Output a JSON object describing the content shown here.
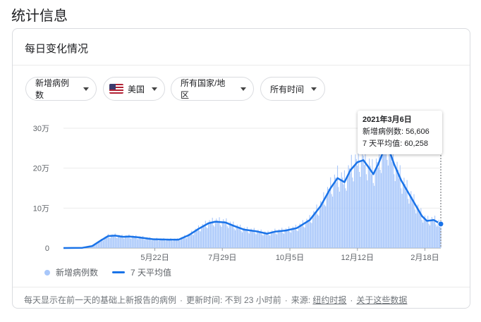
{
  "page_title": "统计信息",
  "card": {
    "title": "每日变化情况"
  },
  "filters": [
    {
      "label": "新增病例数"
    },
    {
      "label": "美国"
    },
    {
      "label": "所有国家/地区"
    },
    {
      "label": "所有时间"
    }
  ],
  "tooltip": {
    "date": "2021年3月6日",
    "cases_label": "新增病例数",
    "cases_value": "56,606",
    "avg_label": "7 天平均值",
    "avg_value": "60,258"
  },
  "legend": {
    "bars_label": "新增病例数",
    "line_label": "7 天平均值"
  },
  "footer": {
    "note": "每天显示在前一天的基础上新报告的病例",
    "updated": "更新时间: 不到 23 小时前",
    "source_label": "来源:",
    "source_link": "纽约时报",
    "about_link": "关于这些数据"
  },
  "colors": {
    "bars": "#a8c7fa",
    "line": "#1a73e8",
    "grid": "#ebebeb"
  },
  "chart_data": {
    "type": "bar",
    "series": [
      {
        "name": "新增病例数",
        "type": "bar"
      },
      {
        "name": "7 天平均值",
        "type": "line"
      }
    ],
    "y_ticks": [
      "0",
      "10万",
      "20万",
      "30万"
    ],
    "ylim": [
      0,
      300000
    ],
    "x_ticks": [
      "5月22日",
      "7月29日",
      "10月5日",
      "12月12日",
      "2月18日"
    ],
    "x_range": [
      "2020-02-20",
      "2021-03-06"
    ],
    "avg_points": [
      [
        "2020-02-20",
        0
      ],
      [
        "2020-03-10",
        500
      ],
      [
        "2020-03-20",
        5000
      ],
      [
        "2020-03-28",
        18000
      ],
      [
        "2020-04-05",
        30000
      ],
      [
        "2020-04-12",
        31000
      ],
      [
        "2020-04-20",
        28000
      ],
      [
        "2020-04-26",
        29000
      ],
      [
        "2020-05-05",
        27000
      ],
      [
        "2020-05-20",
        22000
      ],
      [
        "2020-06-05",
        21000
      ],
      [
        "2020-06-15",
        21000
      ],
      [
        "2020-06-25",
        32000
      ],
      [
        "2020-07-05",
        48000
      ],
      [
        "2020-07-15",
        62000
      ],
      [
        "2020-07-22",
        66000
      ],
      [
        "2020-08-01",
        64000
      ],
      [
        "2020-08-10",
        55000
      ],
      [
        "2020-08-20",
        46000
      ],
      [
        "2020-09-01",
        42000
      ],
      [
        "2020-09-12",
        36000
      ],
      [
        "2020-09-20",
        41000
      ],
      [
        "2020-10-01",
        44000
      ],
      [
        "2020-10-12",
        50000
      ],
      [
        "2020-10-25",
        70000
      ],
      [
        "2020-11-05",
        105000
      ],
      [
        "2020-11-15",
        150000
      ],
      [
        "2020-11-22",
        175000
      ],
      [
        "2020-11-29",
        165000
      ],
      [
        "2020-12-05",
        195000
      ],
      [
        "2020-12-12",
        215000
      ],
      [
        "2020-12-18",
        220000
      ],
      [
        "2020-12-24",
        200000
      ],
      [
        "2020-12-28",
        185000
      ],
      [
        "2021-01-02",
        210000
      ],
      [
        "2021-01-08",
        248000
      ],
      [
        "2021-01-12",
        252000
      ],
      [
        "2021-01-18",
        210000
      ],
      [
        "2021-01-25",
        170000
      ],
      [
        "2021-02-01",
        140000
      ],
      [
        "2021-02-08",
        110000
      ],
      [
        "2021-02-15",
        80000
      ],
      [
        "2021-02-20",
        68000
      ],
      [
        "2021-02-27",
        70000
      ],
      [
        "2021-03-06",
        60258
      ]
    ],
    "highlight": {
      "date": "2021-03-06",
      "cases": 56606,
      "avg": 60258
    }
  }
}
